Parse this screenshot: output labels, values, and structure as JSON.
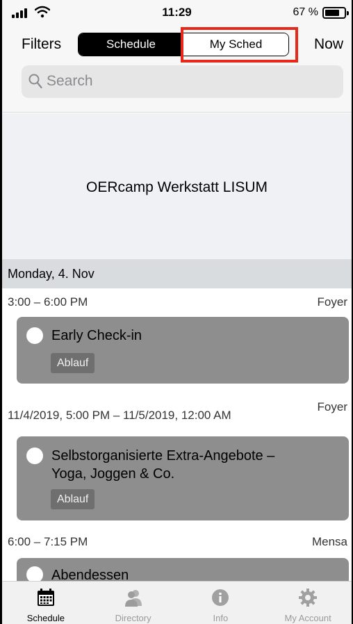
{
  "status_bar": {
    "time": "11:29",
    "battery": "67 %"
  },
  "header": {
    "filters_label": "Filters",
    "now_label": "Now",
    "segments": [
      "Schedule",
      "My Sched"
    ],
    "search_placeholder": "Search"
  },
  "banner": {
    "title": "OERcamp Werkstatt LISUM"
  },
  "day_header": "Monday, 4. Nov",
  "sessions": [
    {
      "time": "3:00 – 6:00 PM",
      "location": "Foyer",
      "title": "Early Check-in",
      "tag": "Ablauf"
    },
    {
      "time": "11/4/2019, 5:00 PM – 11/5/2019, 12:00 AM",
      "location": "Foyer",
      "title_lines": [
        "Selbstorganisierte Extra-Angebote –",
        "Yoga, Joggen & Co."
      ],
      "tag": "Ablauf"
    },
    {
      "time": "6:00 – 7:15 PM",
      "location": "Mensa",
      "title": "Abendessen"
    }
  ],
  "tabbar": {
    "items": [
      {
        "label": "Schedule",
        "icon": "calendar-icon",
        "active": true
      },
      {
        "label": "Directory",
        "icon": "people-icon",
        "active": false
      },
      {
        "label": "Info",
        "icon": "info-icon",
        "active": false
      },
      {
        "label": "My Account",
        "icon": "gear-icon",
        "active": false
      }
    ]
  },
  "colors": {
    "highlight": "#e8281a",
    "card": "#8e8e8e",
    "segment_active": "#000000"
  }
}
